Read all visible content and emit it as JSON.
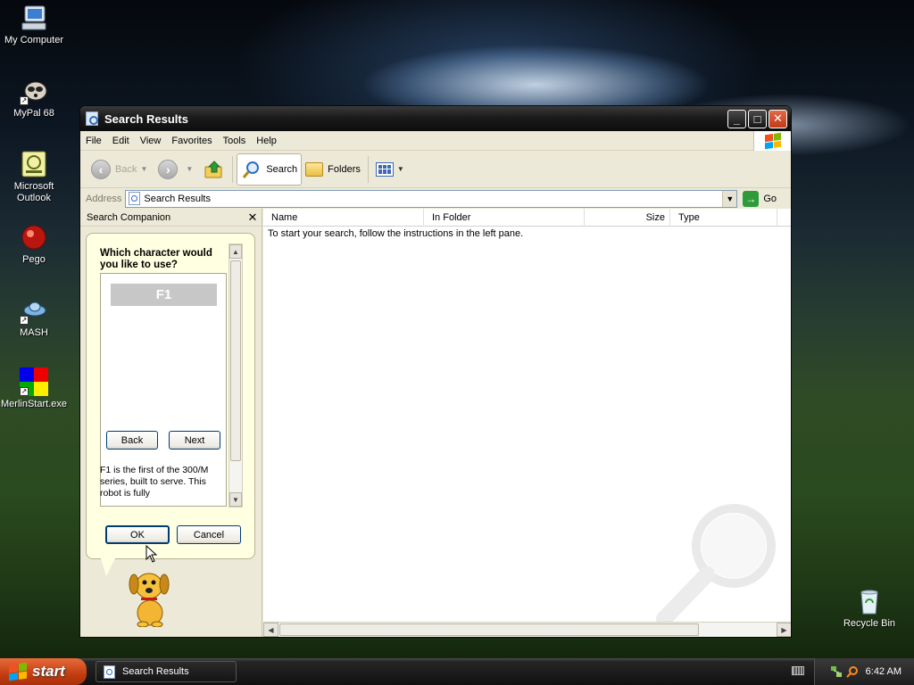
{
  "desktop": {
    "icons": [
      {
        "label": "My Computer"
      },
      {
        "label": "MyPal 68"
      },
      {
        "label": "Microsoft Outlook"
      },
      {
        "label": "Pego"
      },
      {
        "label": "MASH"
      },
      {
        "label": "MerlinStart.exe"
      },
      {
        "label": "Recycle Bin"
      }
    ]
  },
  "window": {
    "title": "Search Results",
    "menu": [
      "File",
      "Edit",
      "View",
      "Favorites",
      "Tools",
      "Help"
    ],
    "toolbar": {
      "back": "Back",
      "search": "Search",
      "folders": "Folders"
    },
    "address": {
      "label": "Address",
      "value": "Search Results",
      "go": "Go"
    }
  },
  "companion": {
    "title": "Search Companion",
    "question": "Which character would you like to use?",
    "selected_character": "F1",
    "back": "Back",
    "next": "Next",
    "description": "F1 is the first of the 300/M series, built to serve. This robot is fully",
    "ok": "OK",
    "cancel": "Cancel"
  },
  "results": {
    "columns": [
      "Name",
      "In Folder",
      "Size",
      "Type"
    ],
    "instructions": "To start your search, follow the instructions in the left pane."
  },
  "taskbar": {
    "start": "start",
    "task": "Search Results",
    "clock": "6:42 AM"
  }
}
